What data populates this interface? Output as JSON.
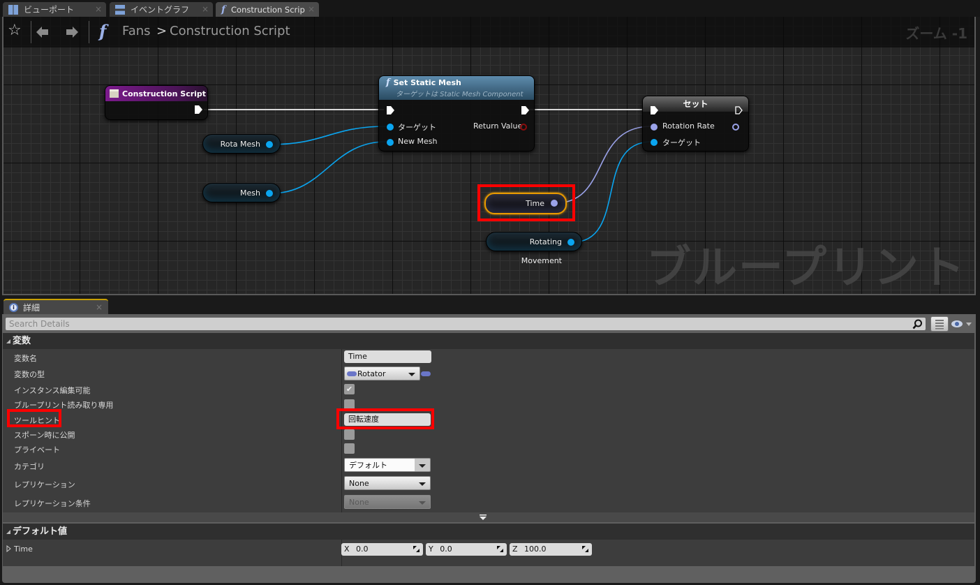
{
  "tabs": [
    {
      "label": "ビューポート",
      "icon": "viewport-grid-icon",
      "active": false
    },
    {
      "label": "イベントグラフ",
      "icon": "event-graph-icon",
      "active": false
    },
    {
      "label": "Construction Scrip",
      "icon": "function-icon",
      "active": true
    }
  ],
  "graph": {
    "breadcrumb": {
      "parent": "Fans",
      "separator": ">",
      "current": "Construction Script"
    },
    "zoom_label": "ズーム -1",
    "watermark": "ブループリント",
    "nodes": {
      "construction_script": {
        "title": "Construction Script",
        "color": "#7a1a8a"
      },
      "set_static_mesh": {
        "title": "Set Static Mesh",
        "subtitle": "ターゲットは Static Mesh Component",
        "pins_in": [
          "ターゲット",
          "New Mesh"
        ],
        "pins_out": [
          "Return Value"
        ]
      },
      "set": {
        "title": "セット",
        "pins_in": [
          "Rotation Rate",
          "ターゲット"
        ]
      },
      "vars": {
        "rota_mesh": "Rota Mesh",
        "mesh": "Mesh",
        "time": "Time",
        "rotating_movement": "Rotating Movement"
      }
    },
    "colors": {
      "object_pin": "#0aa5f0",
      "rotator_pin": "#9aa2e8",
      "return_pin": "#8a0d0d",
      "highlight": "#ff0000",
      "selected": "#e89a00"
    }
  },
  "details": {
    "tab_label": "詳細",
    "search_placeholder": "Search Details",
    "section_variables": "変数",
    "rows": [
      {
        "label": "変数名",
        "value": "Time"
      },
      {
        "label": "変数の型",
        "value": "Rotator"
      },
      {
        "label": "インスタンス編集可能",
        "checked": true
      },
      {
        "label": "ブループリント読み取り専用",
        "checked": false
      },
      {
        "label": "ツールヒント",
        "value": "回転速度"
      },
      {
        "label": "スポーン時に公開",
        "checked": false
      },
      {
        "label": "プライベート",
        "checked": false
      },
      {
        "label": "カテゴリ",
        "value": "デフォルト"
      },
      {
        "label": "レプリケーション",
        "value": "None"
      },
      {
        "label": "レプリケーション条件",
        "value": "None"
      }
    ],
    "section_defaults": "デフォルト値",
    "default_row": {
      "label": "Time",
      "x_label": "X",
      "x": "0.0",
      "y_label": "Y",
      "y": "0.0",
      "z_label": "Z",
      "z": "100.0"
    }
  }
}
